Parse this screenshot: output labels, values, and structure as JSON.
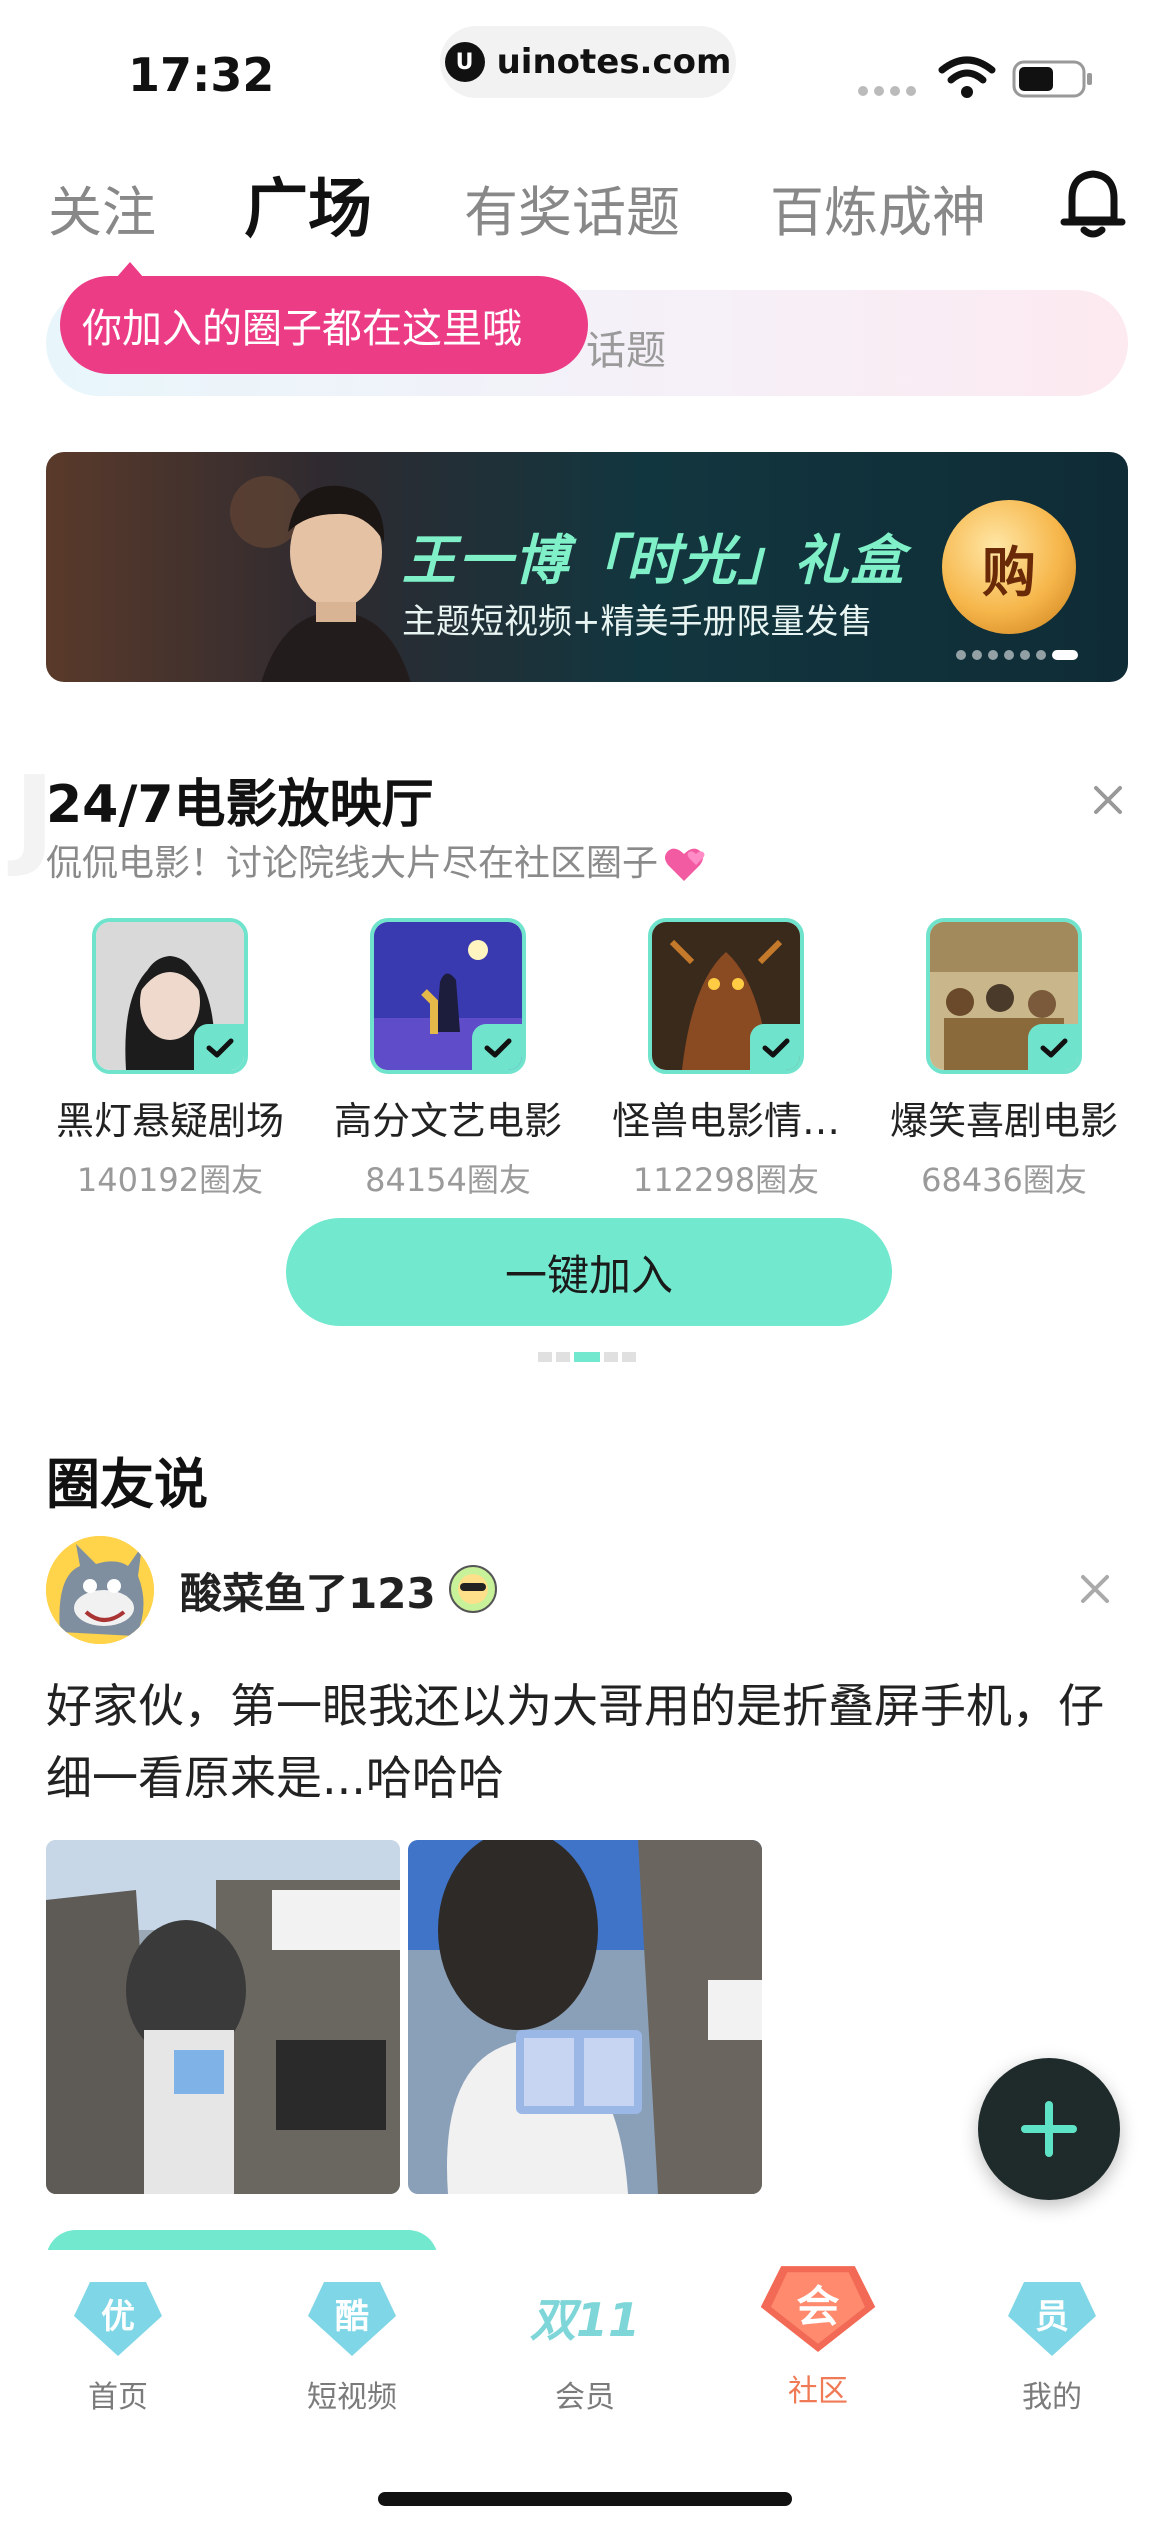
{
  "status_bar": {
    "time": "17:32",
    "url": "uinotes.com",
    "url_logo": "U"
  },
  "top_tabs": [
    {
      "label": "关注",
      "active": false
    },
    {
      "label": "广场",
      "active": true
    },
    {
      "label": "有奖话题",
      "active": false
    },
    {
      "label": "百炼成神",
      "active": false
    }
  ],
  "search": {
    "visible_text": "话题"
  },
  "tooltip": {
    "text": "你加入的圈子都在这里哦"
  },
  "banner": {
    "title": "王一博「时光」礼盒",
    "subtitle": "主题短视频+精美手册限量发售",
    "button": "购"
  },
  "cinema": {
    "watermark": "J",
    "title": "24/7电影放映厅",
    "subtitle": "侃侃电影！讨论院线大片尽在社区圈子",
    "circles": [
      {
        "name": "黑灯悬疑剧场",
        "count": "140192圈友"
      },
      {
        "name": "高分文艺电影",
        "count": "84154圈友"
      },
      {
        "name": "怪兽电影情…",
        "count": "112298圈友"
      },
      {
        "name": "爆笑喜剧电影",
        "count": "68436圈友"
      }
    ],
    "join_button": "一键加入"
  },
  "feed": {
    "section_title": "圈友说",
    "post": {
      "username": "酸菜鱼了123",
      "text": "好家伙，第一眼我还以为大哥用的是折叠屏手机，仔细一看原来是...哈哈哈"
    }
  },
  "bottom_nav": [
    {
      "icon": "优",
      "label": "首页",
      "active": false
    },
    {
      "icon": "酷",
      "label": "短视频",
      "active": false
    },
    {
      "icon": "双11",
      "label": "会员",
      "active": false
    },
    {
      "icon": "会",
      "label": "社区",
      "active": true
    },
    {
      "icon": "员",
      "label": "我的",
      "active": false
    }
  ],
  "colors": {
    "accent_mint": "#72e8cf",
    "tooltip_pink": "#ec3c86",
    "active_nav": "#f07a55"
  }
}
